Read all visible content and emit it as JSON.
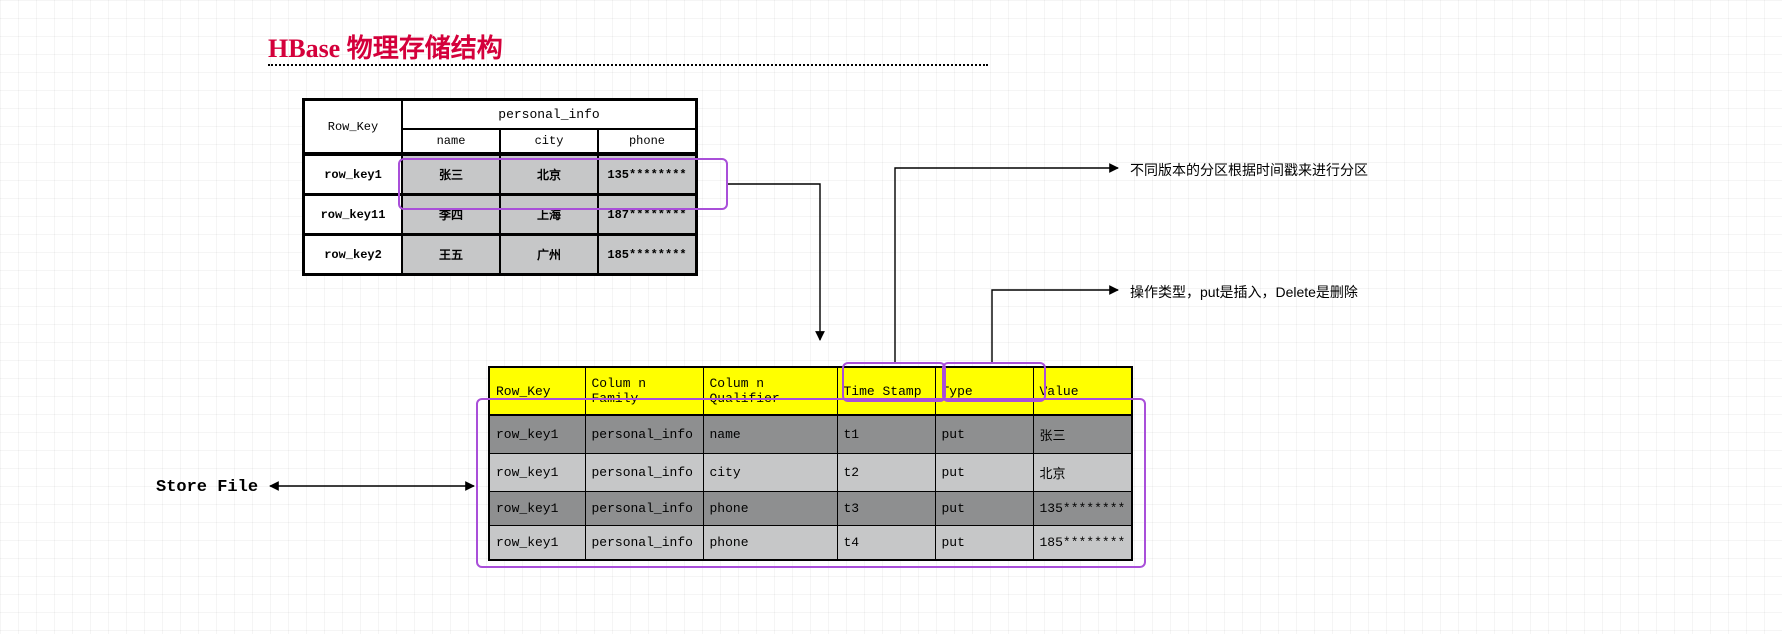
{
  "title": "HBase 物理存储结构",
  "logical_table": {
    "row_key_header": "Row_Key",
    "cf_header": "personal_info",
    "subheaders": {
      "name": "name",
      "city": "city",
      "phone": "phone"
    },
    "rows": [
      {
        "rk": "row_key1",
        "name": "张三",
        "city": "北京",
        "phone": "135********"
      },
      {
        "rk": "row_key11",
        "name": "李四",
        "city": "上海",
        "phone": "187********"
      },
      {
        "rk": "row_key2",
        "name": "王五",
        "city": "广州",
        "phone": "185********"
      }
    ]
  },
  "physical_table": {
    "headers": {
      "row_key": "Row_Key",
      "cf": "Colum n Family",
      "cq": "Colum n Qualifier",
      "ts": "Time Stamp",
      "type": "Type",
      "value": "Value"
    },
    "rows": [
      {
        "rk": "row_key1",
        "cf": "personal_info",
        "cq": "name",
        "ts": "t1",
        "type": "put",
        "value": "张三"
      },
      {
        "rk": "row_key1",
        "cf": "personal_info",
        "cq": "city",
        "ts": "t2",
        "type": "put",
        "value": "北京"
      },
      {
        "rk": "row_key1",
        "cf": "personal_info",
        "cq": "phone",
        "ts": "t3",
        "type": "put",
        "value": "135********"
      },
      {
        "rk": "row_key1",
        "cf": "personal_info",
        "cq": "phone",
        "ts": "t4",
        "type": "put",
        "value": "185********"
      }
    ]
  },
  "annotations": {
    "timestamp": "不同版本的分区根据时间戳来进行分区",
    "type": "操作类型，put是插入，Delete是删除",
    "store_file": "Store  File"
  }
}
